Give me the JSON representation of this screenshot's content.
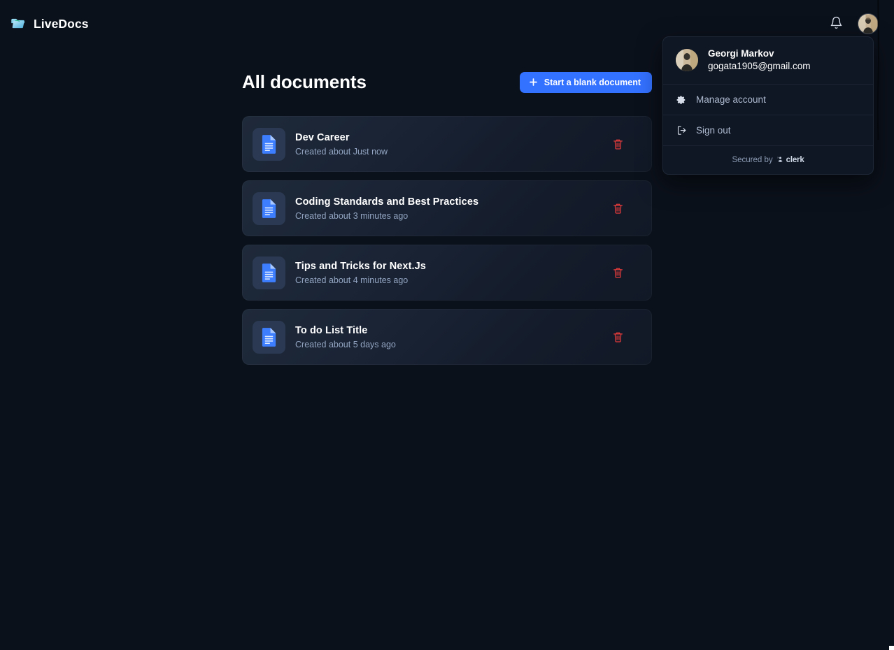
{
  "app": {
    "brand_name": "LiveDocs",
    "logo_icon": "folder-logo-icon"
  },
  "header": {
    "notifications_icon": "bell-icon",
    "avatar_icon": "user-avatar",
    "avatar_label": "Georgi Markov"
  },
  "main": {
    "page_title": "All documents",
    "new_document_button": {
      "label": "Start a blank document",
      "icon": "plus-icon",
      "color": "#3371ff"
    },
    "documents": [
      {
        "title": "Dev Career",
        "created": "Created about Just now",
        "icon": "document-icon",
        "delete_icon": "trash-icon"
      },
      {
        "title": "Coding Standards and Best Practices",
        "created": "Created about 3 minutes ago",
        "icon": "document-icon",
        "delete_icon": "trash-icon"
      },
      {
        "title": "Tips and Tricks for Next.Js",
        "created": "Created about 4 minutes ago",
        "icon": "document-icon",
        "delete_icon": "trash-icon"
      },
      {
        "title": "To do List Title",
        "created": "Created about 5 days ago",
        "icon": "document-icon",
        "delete_icon": "trash-icon"
      }
    ]
  },
  "user_menu": {
    "open": true,
    "name": "Georgi Markov",
    "email": "gogata1905@gmail.com",
    "avatar_icon": "user-avatar",
    "items": [
      {
        "label": "Manage account",
        "icon": "gear-icon"
      },
      {
        "label": "Sign out",
        "icon": "sign-out-icon"
      }
    ],
    "footer": {
      "secured_text": "Secured by",
      "provider": "clerk",
      "provider_icon": "clerk-icon"
    }
  },
  "theme": {
    "background": "#0b111b",
    "card_background": "#1a2435",
    "accent": "#3371ff",
    "danger": "#e23b3b",
    "muted_text": "#93a5c2"
  }
}
